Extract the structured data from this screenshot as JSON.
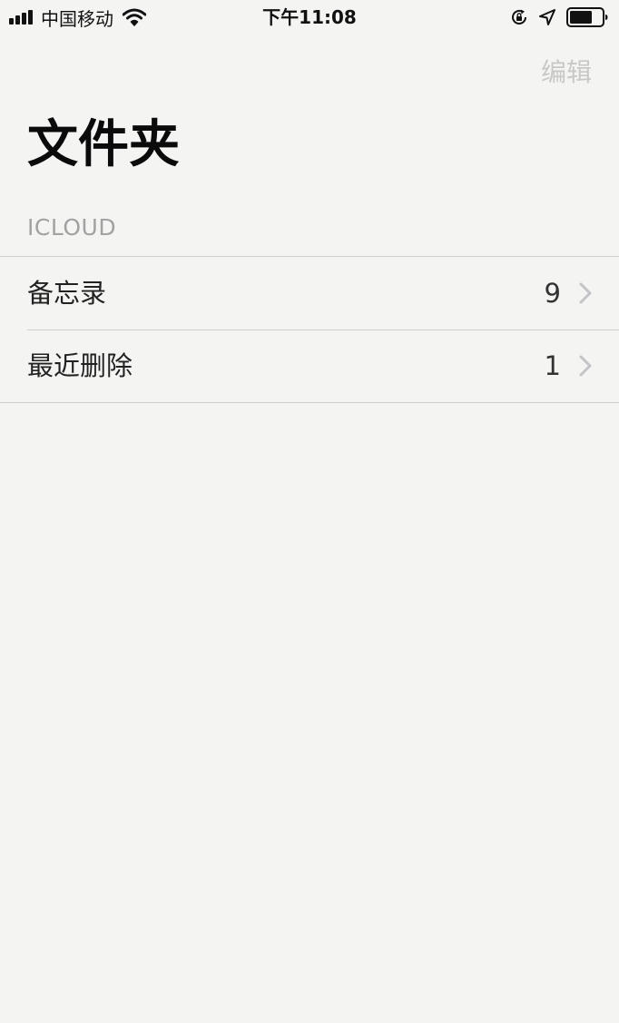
{
  "status_bar": {
    "carrier": "中国移动",
    "time": "下午11:08"
  },
  "nav": {
    "edit_label": "编辑"
  },
  "page_title": "文件夹",
  "section": {
    "header": "ICLOUD",
    "folders": [
      {
        "label": "备忘录",
        "count": "9"
      },
      {
        "label": "最近删除",
        "count": "1"
      }
    ]
  },
  "colors": {
    "background": "#f4f4f3",
    "edit_disabled": "#c8c8c6",
    "section_header": "#a2a2a2",
    "separator": "#cfcfcd",
    "chevron": "#c4c4c6"
  },
  "icons": {
    "signal": "cellular-signal-icon",
    "wifi": "wifi-icon",
    "rotation_lock": "rotation-lock-icon",
    "location": "location-arrow-icon",
    "battery": "battery-icon",
    "row_disclosure": "chevron-right-icon"
  }
}
